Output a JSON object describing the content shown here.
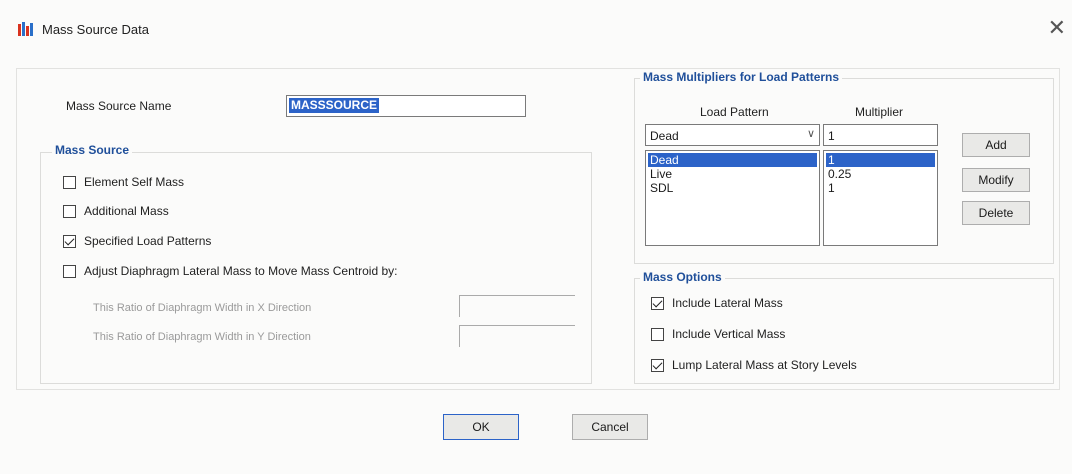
{
  "window": {
    "title": "Mass Source Data",
    "close_glyph": "✕"
  },
  "name_field": {
    "label": "Mass Source Name",
    "value": "MASSSOURCE"
  },
  "mass_source": {
    "title": "Mass Source",
    "element_self_mass": {
      "label": "Element Self Mass",
      "checked": false
    },
    "additional_mass": {
      "label": "Additional Mass",
      "checked": false
    },
    "specified_load_patterns": {
      "label": "Specified Load Patterns",
      "checked": true
    },
    "adjust_diaphragm": {
      "label": "Adjust Diaphragm Lateral Mass to Move Mass Centroid by:",
      "checked": false
    },
    "ratio_x_label": "This Ratio of Diaphragm Width in X Direction",
    "ratio_y_label": "This Ratio of Diaphragm Width in Y Direction"
  },
  "multipliers": {
    "title": "Mass Multipliers for Load Patterns",
    "col_load_pattern": "Load Pattern",
    "col_multiplier": "Multiplier",
    "selected_pattern": "Dead",
    "multiplier_value": "1",
    "rows": [
      {
        "pattern": "Dead",
        "multiplier": "1"
      },
      {
        "pattern": "Live",
        "multiplier": "0.25"
      },
      {
        "pattern": "SDL",
        "multiplier": "1"
      }
    ],
    "add_label": "Add",
    "modify_label": "Modify",
    "delete_label": "Delete"
  },
  "mass_options": {
    "title": "Mass Options",
    "include_lateral": {
      "label": "Include Lateral Mass",
      "checked": true
    },
    "include_vertical": {
      "label": "Include Vertical Mass",
      "checked": false
    },
    "lump_lateral": {
      "label": "Lump Lateral Mass at Story Levels",
      "checked": true
    }
  },
  "buttons": {
    "ok": "OK",
    "cancel": "Cancel"
  },
  "colors": {
    "accent": "#2c63c8",
    "group_title": "#1f4f9a"
  }
}
